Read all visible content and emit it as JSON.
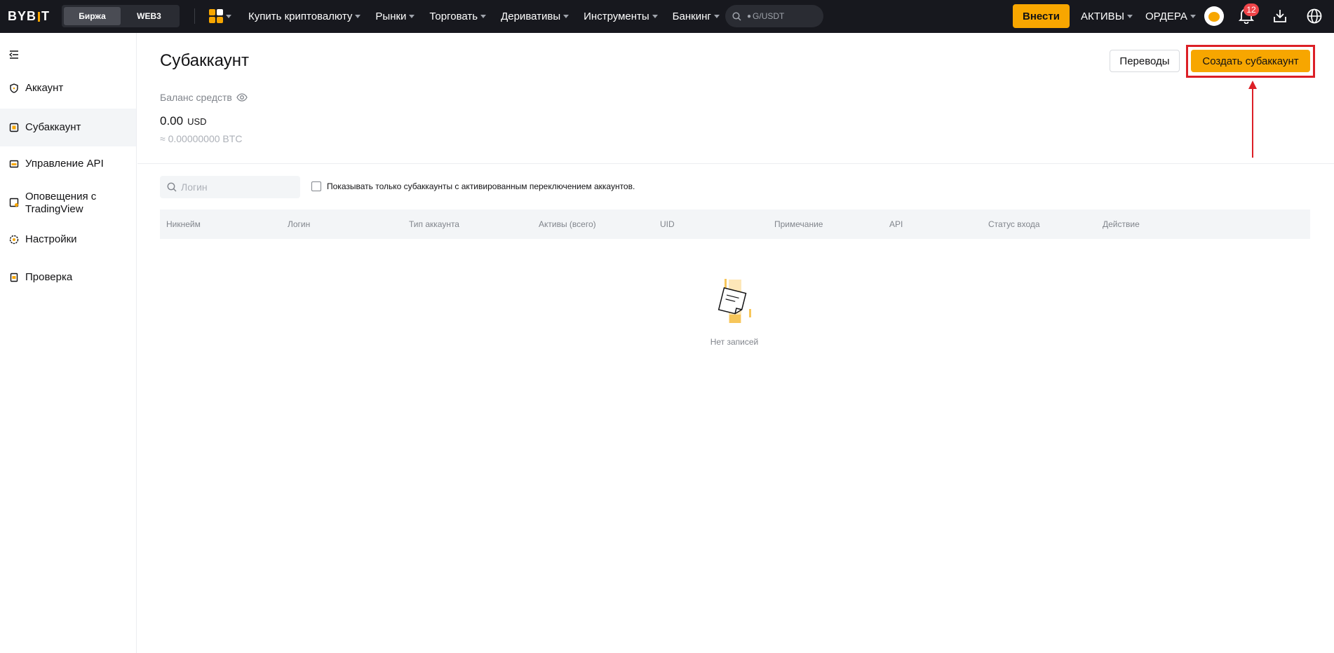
{
  "header": {
    "logo_text": "BYB",
    "logo_text_end": "T",
    "mode_tabs": [
      "Биржа",
      "WEB3"
    ],
    "nav": [
      "Купить криптовалюту",
      "Рынки",
      "Торговать",
      "Деривативы",
      "Инструменты",
      "Банкинг"
    ],
    "search_placeholder": "G/USDT",
    "deposit_label": "Внести",
    "assets_label": "АКТИВЫ",
    "orders_label": "ОРДЕРА",
    "notifications_count": "12",
    "accent_color": "#f7a600"
  },
  "sidebar": {
    "items": [
      {
        "label": "Аккаунт",
        "icon": "shield-icon"
      },
      {
        "label": "Субаккаунт",
        "icon": "subaccount-icon"
      },
      {
        "label": "Управление API",
        "icon": "api-icon"
      },
      {
        "label": "Оповещения с TradingView",
        "icon": "tradingview-icon"
      },
      {
        "label": "Настройки",
        "icon": "settings-icon"
      },
      {
        "label": "Проверка",
        "icon": "verification-icon"
      }
    ]
  },
  "main": {
    "title": "Субаккаунт",
    "transfers_label": "Переводы",
    "create_label": "Создать субаккаунт",
    "balance_label": "Баланс средств",
    "balance_value": "0.00",
    "balance_currency": "USD",
    "balance_btc": "≈ 0.00000000 BTC",
    "login_placeholder": "Логин",
    "only_switch_label": "Показывать только субаккаунты с активированным переключением аккаунтов.",
    "columns": [
      "Никнейм",
      "Логин",
      "Тип аккаунта",
      "Активы (всего)",
      "UID",
      "Примечание",
      "API",
      "Статус входа",
      "Действие"
    ],
    "empty_text": "Нет записей"
  }
}
